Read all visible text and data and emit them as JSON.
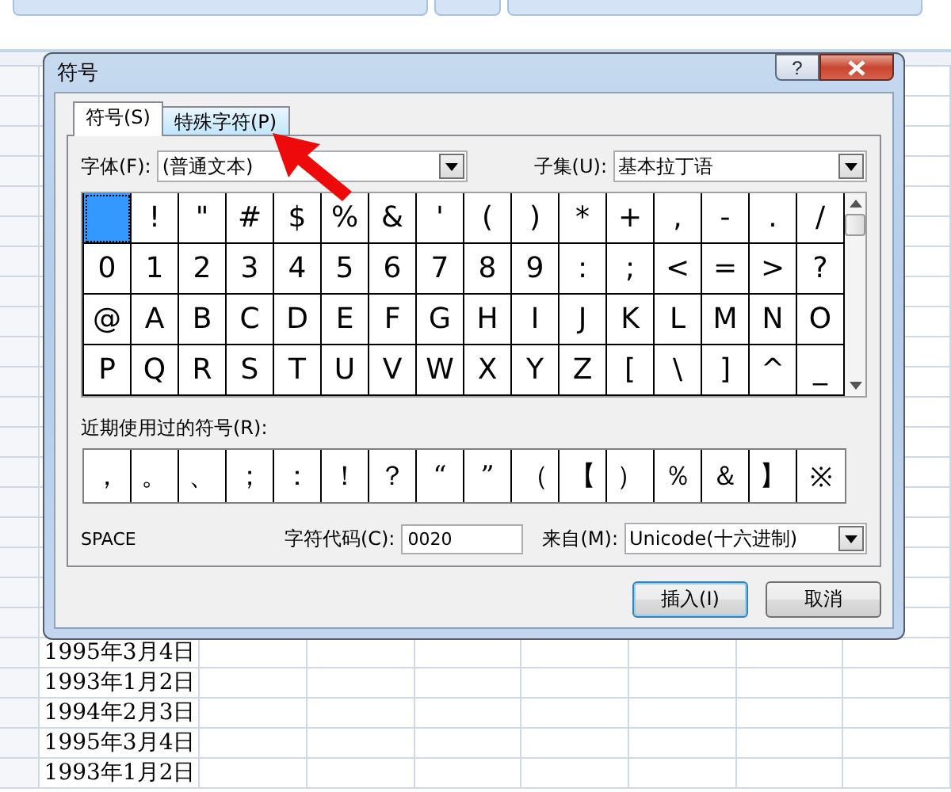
{
  "window": {
    "title": "符号",
    "help_button": "?"
  },
  "tabs": [
    {
      "label": "符号(S)",
      "selected": true
    },
    {
      "label": "特殊字符(P)",
      "selected": false
    }
  ],
  "font": {
    "label": "字体(F):",
    "value": "(普通文本)"
  },
  "subset": {
    "label": "子集(U):",
    "value": "基本拉丁语"
  },
  "symbol_rows": [
    {
      "cells": [
        {
          "selected": true
        },
        {
          "char": "!",
          "selected": false
        },
        {
          "char": "\"",
          "selected": false
        },
        {
          "char": "#",
          "selected": false
        },
        {
          "char": "$",
          "selected": false
        },
        {
          "char": "%",
          "selected": false
        },
        {
          "char": "&",
          "selected": false
        },
        {
          "char": "'",
          "selected": false
        },
        {
          "char": "(",
          "selected": false
        },
        {
          "char": ")",
          "selected": false
        },
        {
          "char": "*",
          "selected": false
        },
        {
          "char": "+",
          "selected": false
        },
        {
          "char": ",",
          "selected": false
        },
        {
          "char": "-",
          "selected": false
        },
        {
          "char": ".",
          "selected": false
        },
        {
          "char": "/",
          "selected": false
        }
      ]
    },
    {
      "cells": [
        {
          "char": "0",
          "selected": false
        },
        {
          "char": "1",
          "selected": false
        },
        {
          "char": "2",
          "selected": false
        },
        {
          "char": "3",
          "selected": false
        },
        {
          "char": "4",
          "selected": false
        },
        {
          "char": "5",
          "selected": false
        },
        {
          "char": "6",
          "selected": false
        },
        {
          "char": "7",
          "selected": false
        },
        {
          "char": "8",
          "selected": false
        },
        {
          "char": "9",
          "selected": false
        },
        {
          "char": ":",
          "selected": false
        },
        {
          "char": ";",
          "selected": false
        },
        {
          "char": "<",
          "selected": false
        },
        {
          "char": "=",
          "selected": false
        },
        {
          "char": ">",
          "selected": false
        },
        {
          "char": "?",
          "selected": false
        }
      ]
    },
    {
      "cells": [
        {
          "char": "@",
          "selected": false
        },
        {
          "char": "A",
          "selected": false
        },
        {
          "char": "B",
          "selected": false
        },
        {
          "char": "C",
          "selected": false
        },
        {
          "char": "D",
          "selected": false
        },
        {
          "char": "E",
          "selected": false
        },
        {
          "char": "F",
          "selected": false
        },
        {
          "char": "G",
          "selected": false
        },
        {
          "char": "H",
          "selected": false
        },
        {
          "char": "I",
          "selected": false
        },
        {
          "char": "J",
          "selected": false
        },
        {
          "char": "K",
          "selected": false
        },
        {
          "char": "L",
          "selected": false
        },
        {
          "char": "M",
          "selected": false
        },
        {
          "char": "N",
          "selected": false
        },
        {
          "char": "O",
          "selected": false
        }
      ]
    },
    {
      "cells": [
        {
          "char": "P",
          "selected": false
        },
        {
          "char": "Q",
          "selected": false
        },
        {
          "char": "R",
          "selected": false
        },
        {
          "char": "S",
          "selected": false
        },
        {
          "char": "T",
          "selected": false
        },
        {
          "char": "U",
          "selected": false
        },
        {
          "char": "V",
          "selected": false
        },
        {
          "char": "W",
          "selected": false
        },
        {
          "char": "X",
          "selected": false
        },
        {
          "char": "Y",
          "selected": false
        },
        {
          "char": "Z",
          "selected": false
        },
        {
          "char": "[",
          "selected": false
        },
        {
          "char": "\\",
          "selected": false
        },
        {
          "char": "]",
          "selected": false
        },
        {
          "char": "^",
          "selected": false
        },
        {
          "char": "_",
          "selected": false
        }
      ]
    }
  ],
  "recent": {
    "label": "近期使用过的符号(R):",
    "symbols": [
      "，",
      "。",
      "、",
      "；",
      "：",
      "！",
      "？",
      "“",
      "”",
      "（",
      "【",
      "）",
      "％",
      "＆",
      "】",
      "※"
    ]
  },
  "char_name": "SPACE",
  "char_code": {
    "label": "字符代码(C):",
    "value": "0020"
  },
  "from": {
    "label": "来自(M):",
    "value": "Unicode(十六进制)"
  },
  "buttons": [
    {
      "label": "插入(I)",
      "kind": "default"
    },
    {
      "label": "取消",
      "kind": "normal"
    }
  ],
  "sheet": {
    "cells": [
      "1995年3月4日",
      "1993年1月2日",
      "1994年2月3日",
      "1995年3月4日",
      "1993年1月2日"
    ]
  }
}
